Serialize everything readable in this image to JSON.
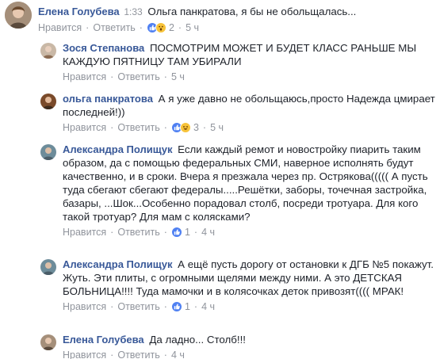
{
  "top_comment": {
    "author": "Елена Голубева",
    "timestamp": "1:33",
    "text": "Ольга панкратова, я бы не обольщалась...",
    "like_label": "Нравится",
    "reply_label": "Ответить",
    "reaction_count": "2",
    "time": "5 ч"
  },
  "replies": [
    {
      "author": "Зося Степанова",
      "text": "ПОСМОТРИМ МОЖЕТ И БУДЕТ КЛАСС РАНЬШЕ МЫ КАЖДУЮ ПЯТНИЦУ ТАМ УБИРАЛИ",
      "like_label": "Нравится",
      "reply_label": "Ответить",
      "time": "5 ч"
    },
    {
      "author": "ольга панкратова",
      "text": "А я уже давно не обольщаюсь,просто Надежда цмирает последней!))",
      "like_label": "Нравится",
      "reply_label": "Ответить",
      "reaction_count": "3",
      "time": "5 ч"
    },
    {
      "author": "Александра Полищук",
      "text": "Если каждый ремот и новостройку пиарить таким образом, да с помощью федеральных СМИ, наверное исполнять будут качественно, и в сроки. Вчера я презжала через пр. Острякова((((( А пусть туда сбегают сбегают федералы.....Решётки, заборы, точечная застройка, базары, ...Шок...Особенно порадовал столб, посреди тротуара. Для кого такой тротуар? Для мам с колясками?",
      "like_label": "Нравится",
      "reply_label": "Ответить",
      "reaction_count": "1",
      "time": "4 ч"
    },
    {
      "author": "Александра Полищук",
      "text": "А ещё пусть дорогу от остановки к ДГБ №5 покажут. Жуть. Эти плиты, с огромными щелями между ними. А это ДЕТСКАЯ БОЛЬНИЦА!!!! Туда мамочки и в колясочках деток привозят(((( МРАК!",
      "like_label": "Нравится",
      "reply_label": "Ответить",
      "reaction_count": "1",
      "time": "4 ч"
    },
    {
      "author": "Елена Голубева",
      "text": "Да ладно... Столб!!!",
      "like_label": "Нравится",
      "reply_label": "Ответить",
      "time": "4 ч"
    }
  ],
  "colors": {
    "author": "#385898",
    "meta": "#90949c",
    "like_reaction": "#4f80f2",
    "haha_reaction": "#f7c33a"
  },
  "icons": {
    "like": "thumbs-up-icon",
    "haha": "haha-icon",
    "wow": "wow-icon"
  }
}
